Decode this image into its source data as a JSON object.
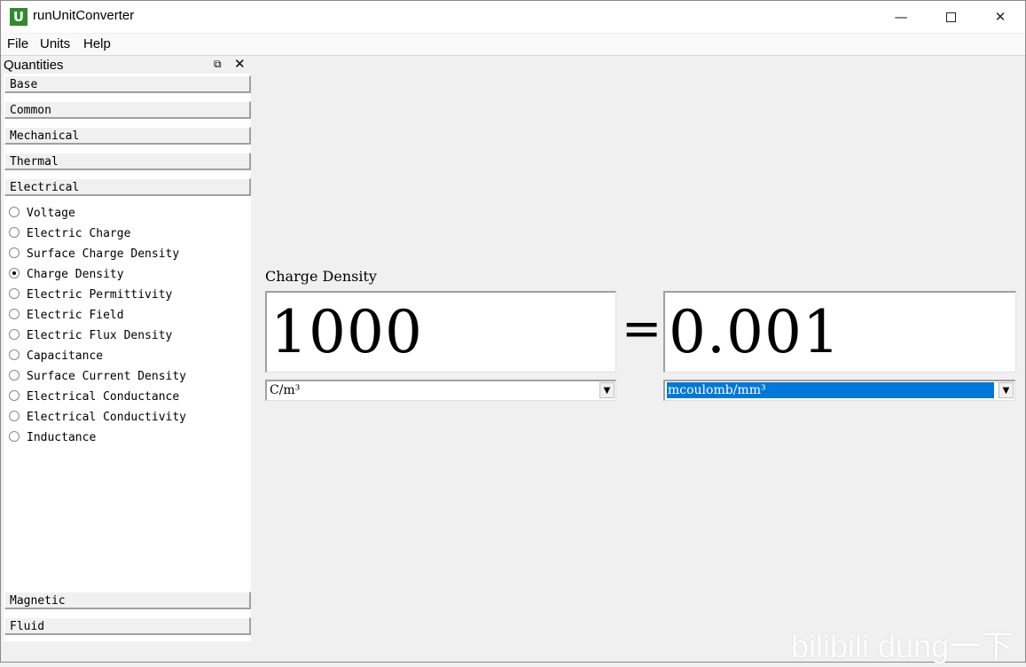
{
  "window": {
    "icon_letter": "U",
    "title": "runUnitConverter",
    "minimize_glyph": "—",
    "close_glyph": "✕"
  },
  "menu": [
    "File",
    "Units",
    "Help"
  ],
  "dock": {
    "title": "Quantities",
    "float_glyph": "⧉",
    "close_glyph": "✕",
    "categories_top": [
      "Base",
      "Common",
      "Mechanical",
      "Thermal",
      "Electrical"
    ],
    "electrical_items": [
      {
        "label": "Voltage",
        "checked": false
      },
      {
        "label": "Electric Charge",
        "checked": false
      },
      {
        "label": "Surface Charge Density",
        "checked": false
      },
      {
        "label": "Charge Density",
        "checked": true
      },
      {
        "label": "Electric Permittivity",
        "checked": false
      },
      {
        "label": "Electric Field",
        "checked": false
      },
      {
        "label": "Electric Flux Density",
        "checked": false
      },
      {
        "label": "Capacitance",
        "checked": false
      },
      {
        "label": "Surface Current Density",
        "checked": false
      },
      {
        "label": "Electrical Conductance",
        "checked": false
      },
      {
        "label": "Electrical Conductivity",
        "checked": false
      },
      {
        "label": "Inductance",
        "checked": false
      }
    ],
    "categories_bottom": [
      "Magnetic",
      "Fluid"
    ]
  },
  "converter": {
    "quantity_label": "Charge Density",
    "left_value": "1000",
    "equals": "=",
    "right_value": "0.001",
    "left_unit": "C/m³",
    "right_unit": "mcoulomb/mm³",
    "arrow_glyph": "▼"
  },
  "watermark": "bilibili dung一下",
  "colors": {
    "selection": "#0078d7",
    "app_icon": "#2e8b2e"
  }
}
